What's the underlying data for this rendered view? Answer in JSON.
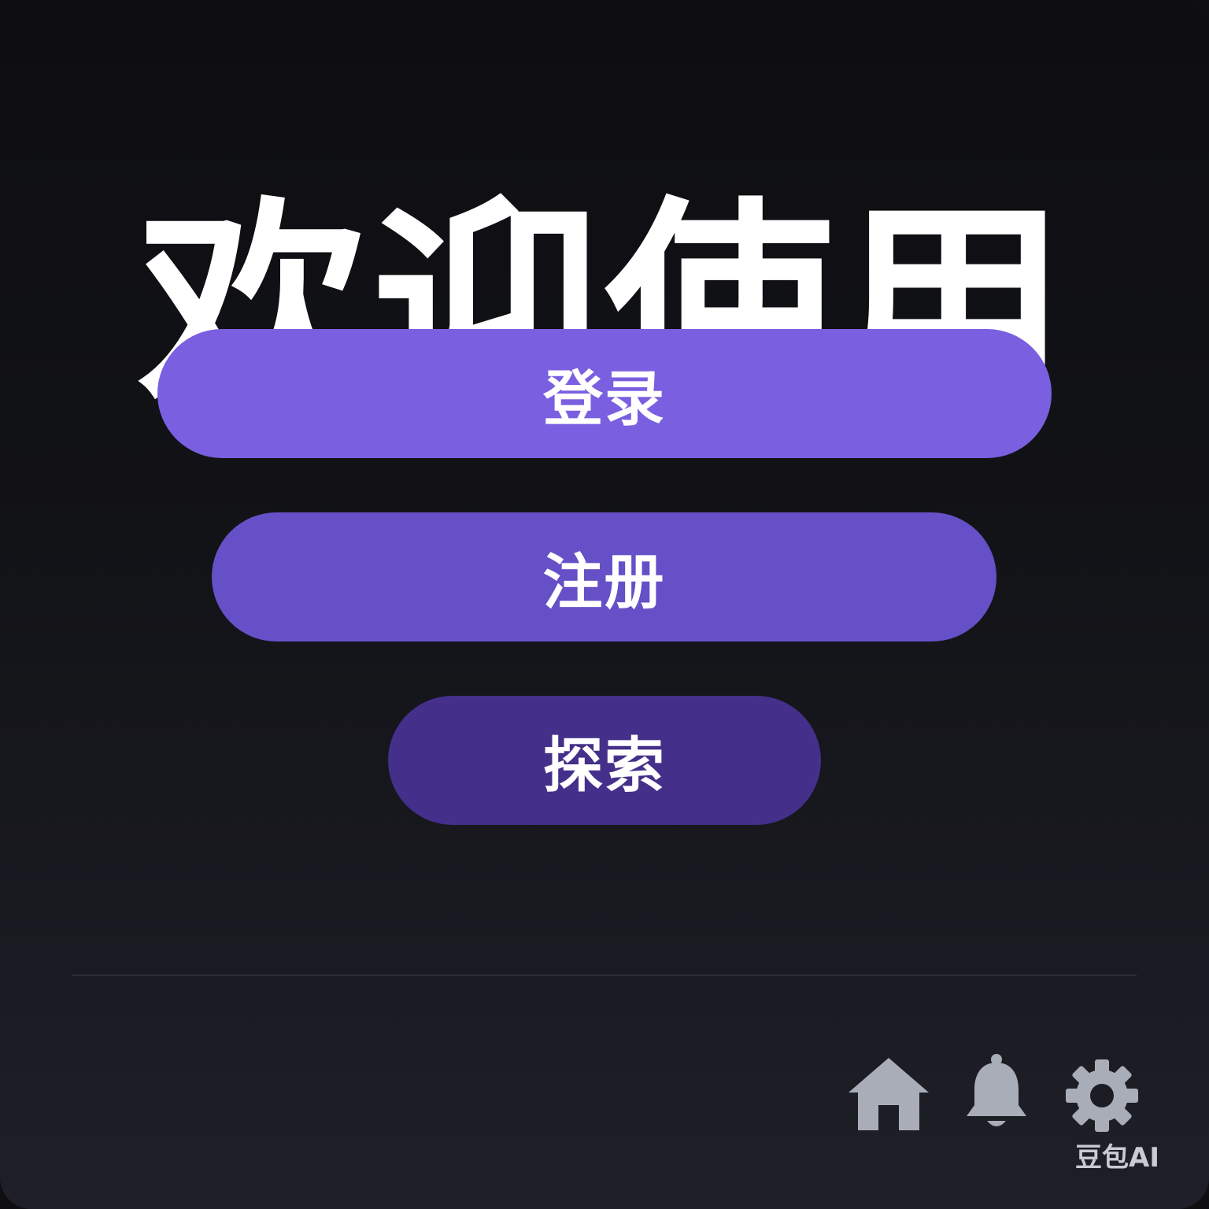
{
  "header": {
    "title": "欢迎使用"
  },
  "actions": {
    "login_label": "登录",
    "register_label": "注册",
    "explore_label": "探索"
  },
  "bottom_nav": {
    "icons": [
      "home-icon",
      "bell-icon",
      "gear-icon"
    ],
    "icon_color": "#a9adb8"
  },
  "watermark": {
    "text": "豆包AI"
  },
  "colors": {
    "login_button": "#7a5fe0",
    "register_button": "#6650c7",
    "explore_button": "#44308a",
    "background": "#121317"
  }
}
